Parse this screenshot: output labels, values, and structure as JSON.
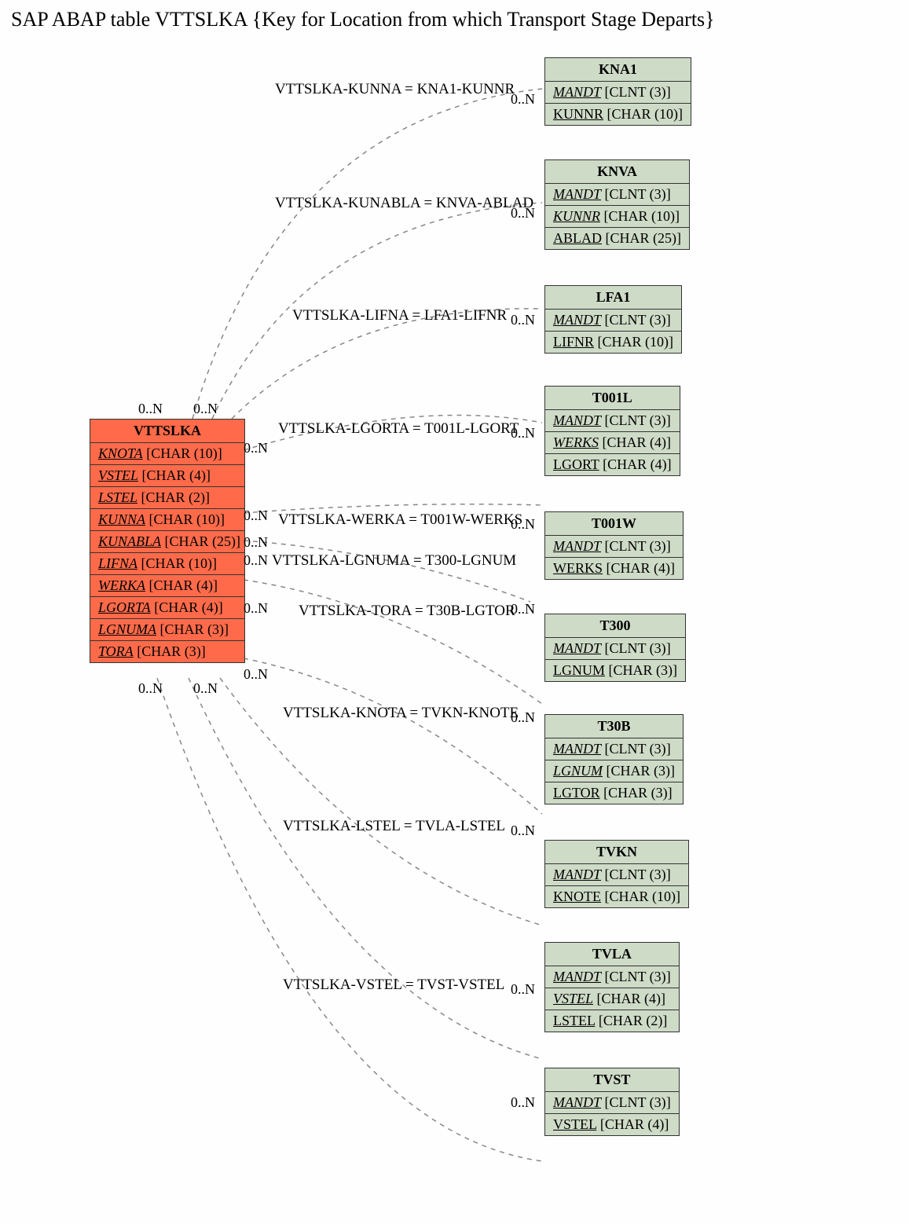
{
  "title": "SAP ABAP table VTTSLKA {Key for Location from which Transport Stage Departs}",
  "mainTable": {
    "name": "VTTSLKA",
    "fields": [
      {
        "name": "KNOTA",
        "type": "CHAR (10)"
      },
      {
        "name": "VSTEL",
        "type": "CHAR (4)"
      },
      {
        "name": "LSTEL",
        "type": "CHAR (2)"
      },
      {
        "name": "KUNNA",
        "type": "CHAR (10)"
      },
      {
        "name": "KUNABLA",
        "type": "CHAR (25)"
      },
      {
        "name": "LIFNA",
        "type": "CHAR (10)"
      },
      {
        "name": "WERKA",
        "type": "CHAR (4)"
      },
      {
        "name": "LGORTA",
        "type": "CHAR (4)"
      },
      {
        "name": "LGNUMA",
        "type": "CHAR (3)"
      },
      {
        "name": "TORA",
        "type": "CHAR (3)"
      }
    ]
  },
  "relations": [
    {
      "label": "VTTSLKA-KUNNA = KNA1-KUNNR"
    },
    {
      "label": "VTTSLKA-KUNABLA = KNVA-ABLAD"
    },
    {
      "label": "VTTSLKA-LIFNA = LFA1-LIFNR"
    },
    {
      "label": "VTTSLKA-LGORTA = T001L-LGORT"
    },
    {
      "label": "VTTSLKA-WERKA = T001W-WERKS"
    },
    {
      "label": "VTTSLKA-LGNUMA = T300-LGNUM"
    },
    {
      "label": "VTTSLKA-TORA = T30B-LGTOR"
    },
    {
      "label": "VTTSLKA-KNOTA = TVKN-KNOTE"
    },
    {
      "label": "VTTSLKA-LSTEL = TVLA-LSTEL"
    },
    {
      "label": "VTTSLKA-VSTEL = TVST-VSTEL"
    }
  ],
  "targets": [
    {
      "name": "KNA1",
      "fields": [
        {
          "n": "MANDT",
          "t": "CLNT (3)",
          "s": "fld"
        },
        {
          "n": "KUNNR",
          "t": "CHAR (10)",
          "s": "fld-u"
        }
      ]
    },
    {
      "name": "KNVA",
      "fields": [
        {
          "n": "MANDT",
          "t": "CLNT (3)",
          "s": "fld"
        },
        {
          "n": "KUNNR",
          "t": "CHAR (10)",
          "s": "fld"
        },
        {
          "n": "ABLAD",
          "t": "CHAR (25)",
          "s": "fld-u"
        }
      ]
    },
    {
      "name": "LFA1",
      "fields": [
        {
          "n": "MANDT",
          "t": "CLNT (3)",
          "s": "fld"
        },
        {
          "n": "LIFNR",
          "t": "CHAR (10)",
          "s": "fld-u"
        }
      ]
    },
    {
      "name": "T001L",
      "fields": [
        {
          "n": "MANDT",
          "t": "CLNT (3)",
          "s": "fld"
        },
        {
          "n": "WERKS",
          "t": "CHAR (4)",
          "s": "fld"
        },
        {
          "n": "LGORT",
          "t": "CHAR (4)",
          "s": "fld-u"
        }
      ]
    },
    {
      "name": "T001W",
      "fields": [
        {
          "n": "MANDT",
          "t": "CLNT (3)",
          "s": "fld"
        },
        {
          "n": "WERKS",
          "t": "CHAR (4)",
          "s": "fld-u"
        }
      ]
    },
    {
      "name": "T300",
      "fields": [
        {
          "n": "MANDT",
          "t": "CLNT (3)",
          "s": "fld"
        },
        {
          "n": "LGNUM",
          "t": "CHAR (3)",
          "s": "fld-u"
        }
      ]
    },
    {
      "name": "T30B",
      "fields": [
        {
          "n": "MANDT",
          "t": "CLNT (3)",
          "s": "fld"
        },
        {
          "n": "LGNUM",
          "t": "CHAR (3)",
          "s": "fld"
        },
        {
          "n": "LGTOR",
          "t": "CHAR (3)",
          "s": "fld-u"
        }
      ]
    },
    {
      "name": "TVKN",
      "fields": [
        {
          "n": "MANDT",
          "t": "CLNT (3)",
          "s": "fld"
        },
        {
          "n": "KNOTE",
          "t": "CHAR (10)",
          "s": "fld-u"
        }
      ]
    },
    {
      "name": "TVLA",
      "fields": [
        {
          "n": "MANDT",
          "t": "CLNT (3)",
          "s": "fld"
        },
        {
          "n": "VSTEL",
          "t": "CHAR (4)",
          "s": "fld"
        },
        {
          "n": "LSTEL",
          "t": "CHAR (2)",
          "s": "fld-u"
        }
      ]
    },
    {
      "name": "TVST",
      "fields": [
        {
          "n": "MANDT",
          "t": "CLNT (3)",
          "s": "fld"
        },
        {
          "n": "VSTEL",
          "t": "CHAR (4)",
          "s": "fld-u"
        }
      ]
    }
  ],
  "cardinality": "0..N"
}
